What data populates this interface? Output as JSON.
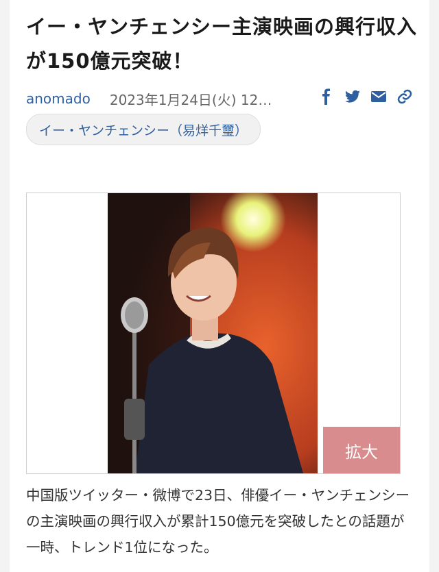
{
  "article": {
    "title": "イー・ヤンチェンシー主演映画の興行収入が150億元突破！",
    "author": "anomado",
    "date": "2023年1月24日(火) 12…",
    "tag": "イー・ヤンチェンシー（易烊千璽）",
    "zoom_label": "拡大",
    "body": "中国版ツイッター・微博で23日、俳優イー・ヤンチェンシーの主演映画の興行収入が累計150億元を突破したとの話題が一時、トレンド1位になった。"
  },
  "share_icons": [
    "facebook-icon",
    "twitter-icon",
    "mail-icon",
    "link-icon"
  ],
  "colors": {
    "link": "#2f5f9e",
    "zoom_button": "#d98c8e"
  }
}
